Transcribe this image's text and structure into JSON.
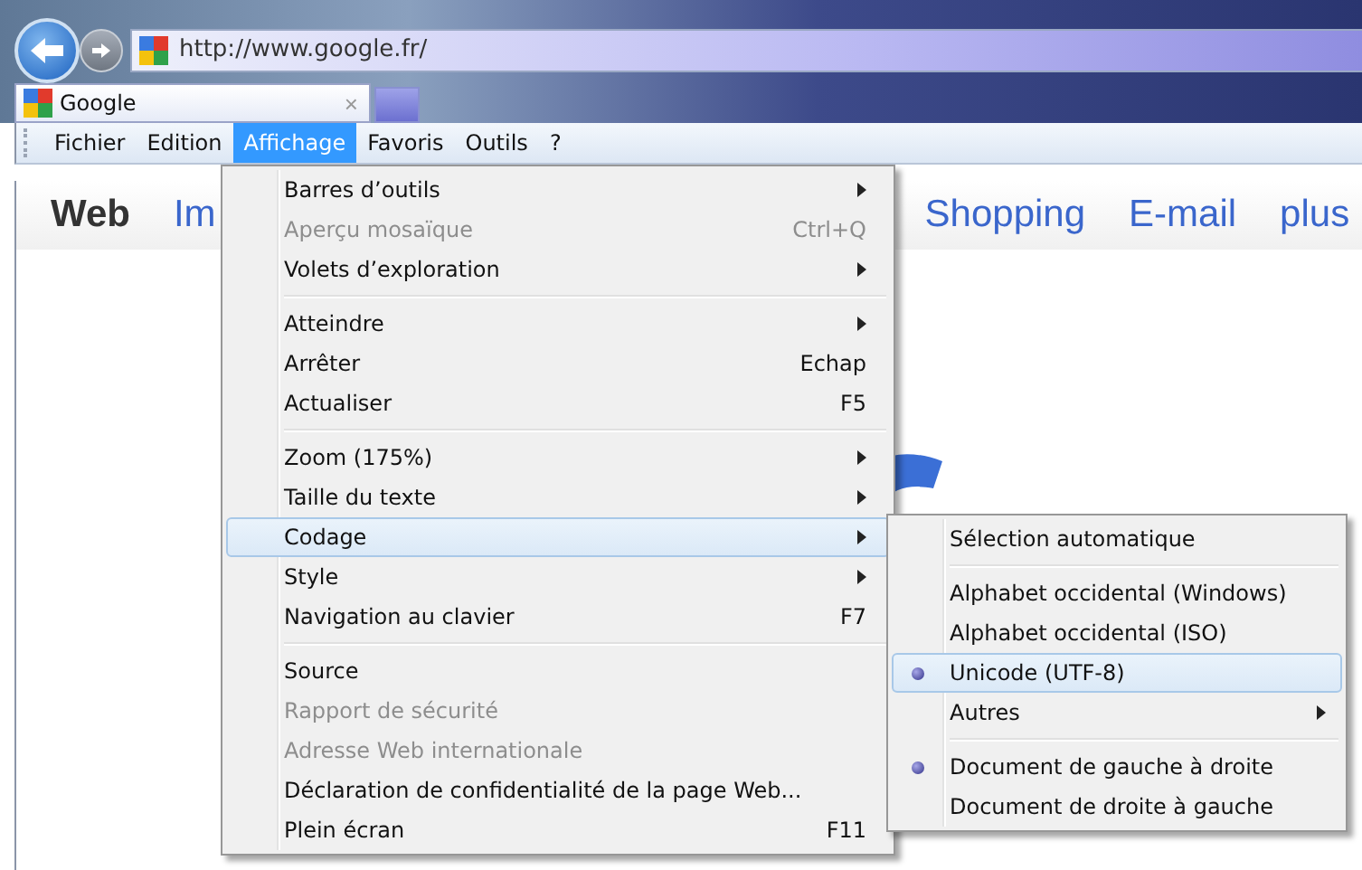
{
  "address_bar": {
    "value": "http://www.google.fr/"
  },
  "tabs": [
    {
      "label": "Google",
      "close": "×",
      "selected": true
    }
  ],
  "menu_bar": [
    {
      "label": "Fichier",
      "selected": false
    },
    {
      "label": "Edition",
      "selected": false
    },
    {
      "label": "Affichage",
      "selected": true
    },
    {
      "label": "Favoris",
      "selected": false
    },
    {
      "label": "Outils",
      "selected": false
    },
    {
      "label": "?",
      "selected": false
    }
  ],
  "page_nav": [
    {
      "label": "Web",
      "selected": true
    },
    {
      "label": "Im",
      "selected": false
    },
    {
      "label": "Shopping",
      "selected": false
    },
    {
      "label": "E-mail",
      "selected": false
    },
    {
      "label": "plus",
      "selected": false
    }
  ],
  "view_menu": [
    {
      "kind": "item",
      "label": "Barres d’outils",
      "submenu": true,
      "disabled": false,
      "selected": false
    },
    {
      "kind": "item",
      "label": "Aperçu mosaïque",
      "shortcut": "Ctrl+Q",
      "submenu": false,
      "disabled": true,
      "selected": false
    },
    {
      "kind": "item",
      "label": "Volets d’exploration",
      "submenu": true,
      "disabled": false,
      "selected": false
    },
    {
      "kind": "separator"
    },
    {
      "kind": "item",
      "label": "Atteindre",
      "submenu": true,
      "disabled": false,
      "selected": false
    },
    {
      "kind": "item",
      "label": "Arrêter",
      "shortcut": "Echap",
      "submenu": false,
      "disabled": false,
      "selected": false
    },
    {
      "kind": "item",
      "label": "Actualiser",
      "shortcut": "F5",
      "submenu": false,
      "disabled": false,
      "selected": false
    },
    {
      "kind": "separator"
    },
    {
      "kind": "item",
      "label": "Zoom (175%)",
      "submenu": true,
      "disabled": false,
      "selected": false
    },
    {
      "kind": "item",
      "label": "Taille du texte",
      "submenu": true,
      "disabled": false,
      "selected": false
    },
    {
      "kind": "item",
      "label": "Codage",
      "submenu": true,
      "disabled": false,
      "selected": true
    },
    {
      "kind": "item",
      "label": "Style",
      "submenu": true,
      "disabled": false,
      "selected": false
    },
    {
      "kind": "item",
      "label": "Navigation au clavier",
      "shortcut": "F7",
      "submenu": false,
      "disabled": false,
      "selected": false
    },
    {
      "kind": "separator"
    },
    {
      "kind": "item",
      "label": "Source",
      "submenu": false,
      "disabled": false,
      "selected": false
    },
    {
      "kind": "item",
      "label": "Rapport de sécurité",
      "submenu": false,
      "disabled": true,
      "selected": false
    },
    {
      "kind": "item",
      "label": "Adresse Web internationale",
      "submenu": false,
      "disabled": true,
      "selected": false
    },
    {
      "kind": "item",
      "label": "Déclaration de confidentialité de la page Web...",
      "submenu": false,
      "disabled": false,
      "selected": false
    },
    {
      "kind": "item",
      "label": "Plein écran",
      "shortcut": "F11",
      "submenu": false,
      "disabled": false,
      "selected": false
    }
  ],
  "encoding_submenu": [
    {
      "kind": "item",
      "label": "Sélection automatique",
      "checked": false,
      "submenu": false,
      "selected": false
    },
    {
      "kind": "separator"
    },
    {
      "kind": "item",
      "label": "Alphabet occidental (Windows)",
      "checked": false,
      "submenu": false,
      "selected": false
    },
    {
      "kind": "item",
      "label": "Alphabet occidental (ISO)",
      "checked": false,
      "submenu": false,
      "selected": false
    },
    {
      "kind": "item",
      "label": "Unicode (UTF-8)",
      "checked": true,
      "submenu": false,
      "selected": true
    },
    {
      "kind": "item",
      "label": "Autres",
      "checked": false,
      "submenu": true,
      "selected": false
    },
    {
      "kind": "separator"
    },
    {
      "kind": "item",
      "label": "Document de gauche à droite",
      "checked": true,
      "submenu": false,
      "selected": false
    },
    {
      "kind": "item",
      "label": "Document de droite à gauche",
      "checked": false,
      "submenu": false,
      "selected": false
    }
  ]
}
